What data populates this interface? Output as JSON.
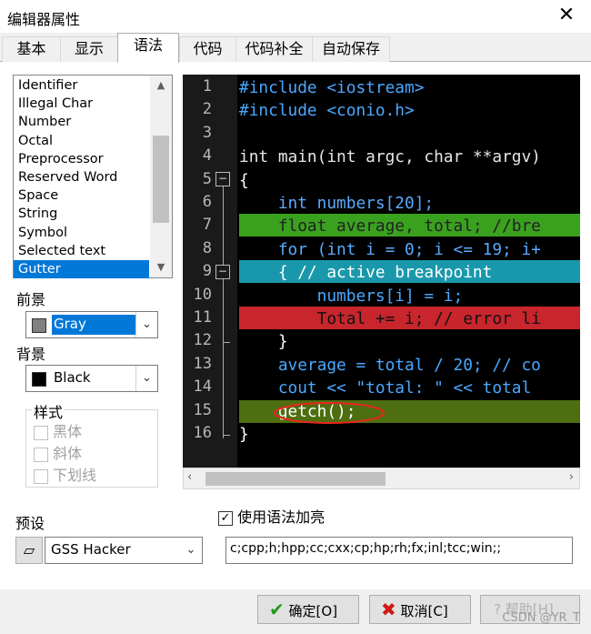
{
  "window": {
    "title": "编辑器属性",
    "close_label": "✕"
  },
  "tabs": [
    "基本",
    "显示",
    "语法",
    "代码",
    "代码补全",
    "自动保存"
  ],
  "element_list": [
    "Identifier",
    "Illegal Char",
    "Number",
    "Octal",
    "Preprocessor",
    "Reserved Word",
    "Space",
    "String",
    "Symbol",
    "Selected text",
    "Gutter"
  ],
  "foreground": {
    "label": "前景",
    "value": "Gray",
    "swatch": "#808080"
  },
  "background": {
    "label": "背景",
    "value": "Black",
    "swatch": "#000000"
  },
  "style": {
    "label": "样式",
    "bold": "黑体",
    "italic": "斜体",
    "underline": "下划线"
  },
  "preview": {
    "line_numbers": [
      "1",
      "2",
      "3",
      "4",
      "5",
      "6",
      "7",
      "8",
      "9",
      "10",
      "11",
      "12",
      "13",
      "14",
      "15",
      "16"
    ],
    "lines": [
      "#include <iostream>",
      "#include <conio.h>",
      "",
      "int main(int argc, char **argv)",
      "{",
      "    int numbers[20];",
      "    float average, total; //bre",
      "    for (int i = 0; i <= 19; i+",
      "    { // active breakpoint",
      "        numbers[i] = i;",
      "        Total += i; // error li",
      "    }",
      "    average = total / 20; // co",
      "    cout << \"total: \" << total",
      "    getch();",
      "}"
    ],
    "breakpoint_color": "#3aa11f",
    "active_breakpoint_color": "#1a98ab",
    "error_color": "#c8252c",
    "selected_color": "#4d6e11"
  },
  "syntax_highlight": {
    "label": "使用语法加亮",
    "checked": true
  },
  "preset": {
    "label": "预设",
    "value": "GSS Hacker"
  },
  "extensions": "c;cpp;h;hpp;cc;cxx;cp;hp;rh;fx;inl;tcc;win;;",
  "buttons": {
    "ok": "确定[O]",
    "cancel": "取消[C]",
    "help": "帮助[H]"
  },
  "watermark": "CSDN @YR_T"
}
